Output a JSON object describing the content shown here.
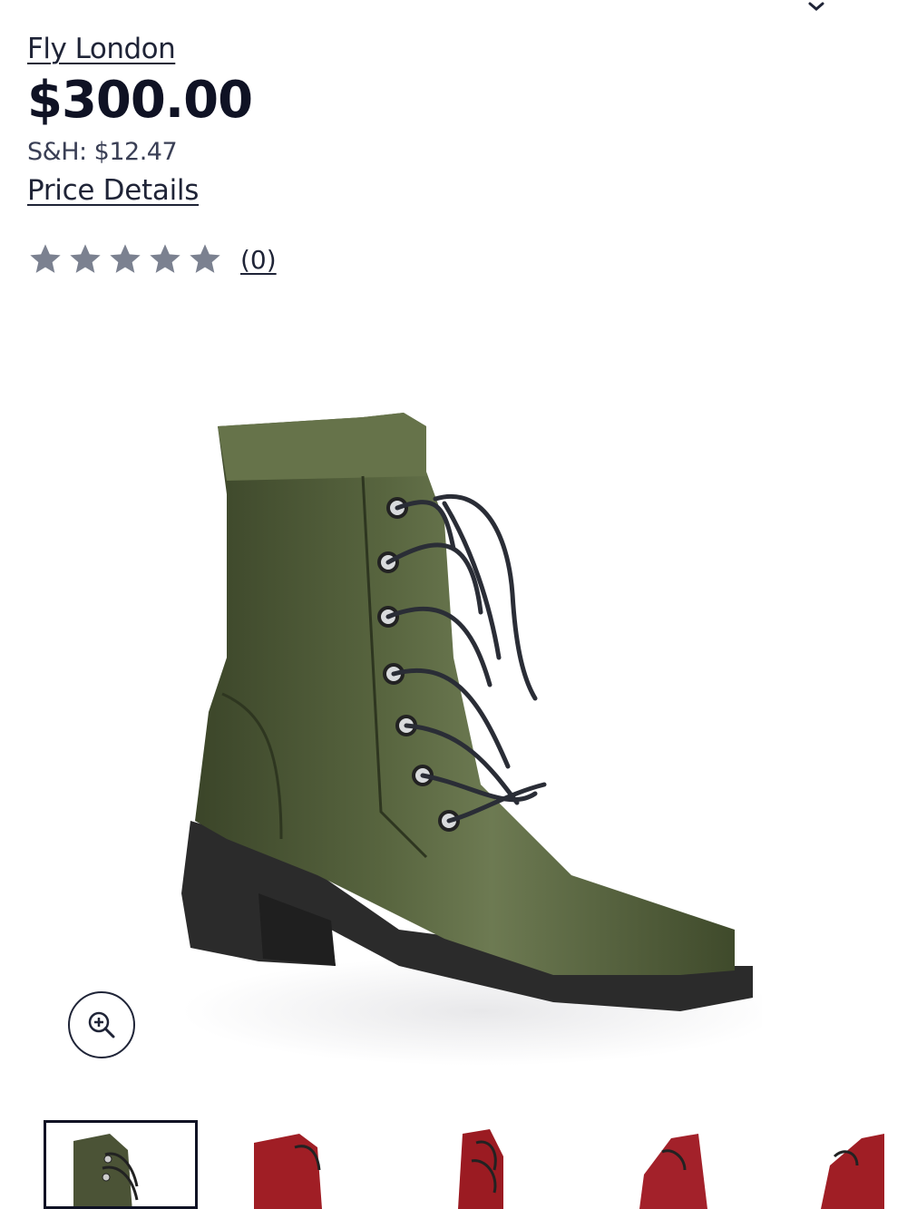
{
  "header": {
    "collapse_icon": "chevron-down-icon"
  },
  "product": {
    "brand": "Fly London",
    "price": "$300.00",
    "shipping": "S&H: $12.47",
    "price_details": "Price Details",
    "rating": {
      "value": 0,
      "max": 5,
      "count": "(0)",
      "star_color": "#7b8190"
    }
  },
  "gallery": {
    "zoom_icon": "zoom-in-icon",
    "main_image": "olive green leather lace-up ankle boot",
    "thumbnails": [
      {
        "color": "olive green",
        "selected": true
      },
      {
        "color": "red",
        "selected": false
      },
      {
        "color": "red",
        "selected": false
      },
      {
        "color": "red",
        "selected": false
      },
      {
        "color": "red",
        "selected": false
      }
    ]
  },
  "colors": {
    "ink": "#0f1224",
    "text": "#1f2437",
    "muted": "#3a3f55",
    "boot_green": "#4a5535",
    "boot_red": "#a01e25",
    "sole": "#2a2a2a"
  }
}
